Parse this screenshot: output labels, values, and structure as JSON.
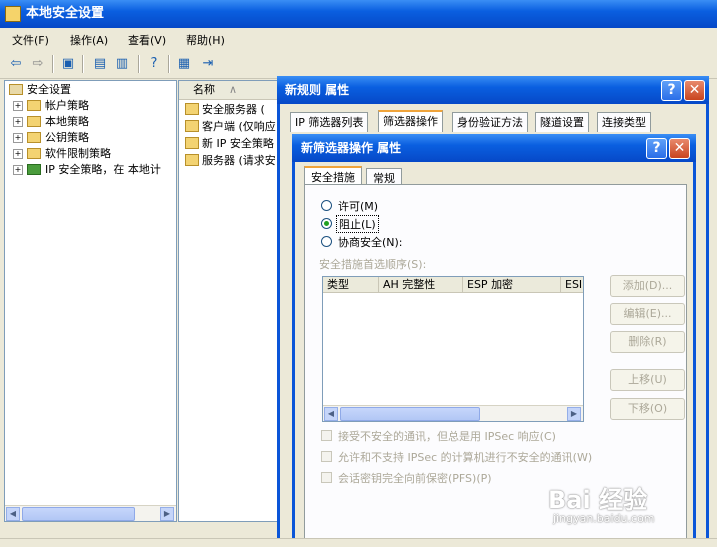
{
  "window": {
    "title": "本地安全设置"
  },
  "menu": [
    "文件(F)",
    "操作(A)",
    "查看(V)",
    "帮助(H)"
  ],
  "toolbar_icons": [
    "back-icon",
    "forward-icon",
    "up-folder-icon",
    "properties-icon",
    "export-list-icon",
    "help-icon",
    "properties-sheet-icon",
    "import-icon"
  ],
  "tree": {
    "root": "安全设置",
    "items": [
      "帐户策略",
      "本地策略",
      "公钥策略",
      "软件限制策略",
      "IP 安全策略，在 本地计"
    ]
  },
  "list": {
    "header": "名称",
    "items": [
      "安全服务器 (",
      "客户端 (仅响应",
      "新 IP 安全策略",
      "服务器 (请求安"
    ]
  },
  "outer_dialog": {
    "title": "新规则 属性",
    "help": "?",
    "close": "✕",
    "tabs": [
      "IP 筛选器列表",
      "筛选器操作",
      "身份验证方法",
      "隧道设置",
      "连接类型"
    ]
  },
  "inner_dialog": {
    "title": "新筛选器操作 属性",
    "help": "?",
    "close": "✕",
    "tabs": [
      "安全措施",
      "常规"
    ],
    "radios": [
      {
        "label": "许可(M)",
        "checked": false
      },
      {
        "label": "阻止(L)",
        "checked": true
      },
      {
        "label": "协商安全(N):",
        "checked": false
      }
    ],
    "order_label": "安全措施首选顺序(S):",
    "columns": [
      "类型",
      "AH 完整性",
      "ESP 加密",
      "ESI"
    ],
    "buttons": [
      "添加(D)...",
      "编辑(E)...",
      "删除(R)",
      "上移(U)",
      "下移(O)"
    ],
    "checkboxes": [
      "接受不安全的通讯，但总是用 IPSec 响应(C)",
      "允许和不支持 IPSec 的计算机进行不安全的通讯(W)",
      "会话密钥完全向前保密(PFS)(P)"
    ]
  },
  "watermark": {
    "brand": "Bai 经验",
    "url": "jingyan.baidu.com"
  }
}
